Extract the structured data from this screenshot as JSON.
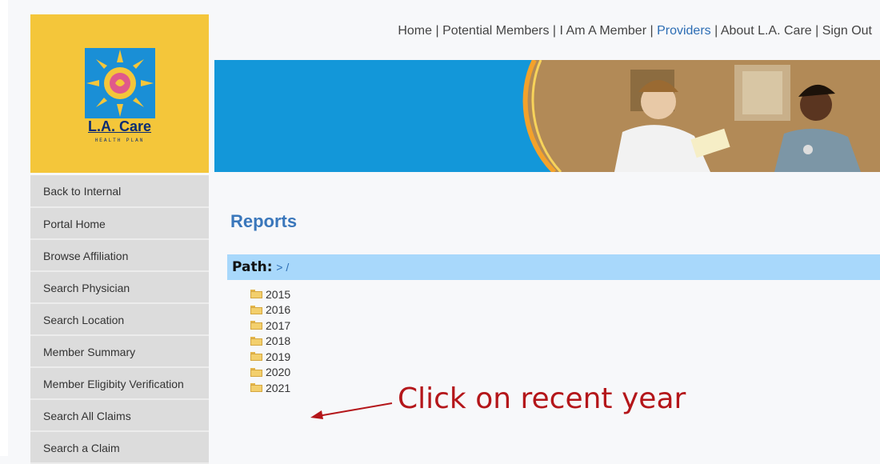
{
  "logo": {
    "brand": "L.A. Care",
    "sub": "HEALTH PLAN"
  },
  "top_nav": [
    {
      "label": "Home",
      "active": false
    },
    {
      "label": "Potential Members",
      "active": false
    },
    {
      "label": "I Am A Member",
      "active": false
    },
    {
      "label": "Providers",
      "active": true
    },
    {
      "label": "About L.A. Care",
      "active": false
    },
    {
      "label": "Sign Out",
      "active": false
    }
  ],
  "sidebar": {
    "items": [
      {
        "label": "Back to Internal"
      },
      {
        "label": "Portal Home"
      },
      {
        "label": "Browse Affiliation"
      },
      {
        "label": "Search Physician"
      },
      {
        "label": "Search Location"
      },
      {
        "label": "Member Summary"
      },
      {
        "label": "Member Eligibity Verification"
      },
      {
        "label": "Search All Claims"
      },
      {
        "label": "Search a Claim"
      }
    ]
  },
  "main": {
    "title": "Reports",
    "path_label": "Path:",
    "path_value": "> /",
    "folders": [
      "2015",
      "2016",
      "2017",
      "2018",
      "2019",
      "2020",
      "2021"
    ]
  },
  "annotation": {
    "text": "Click on recent year"
  },
  "colors": {
    "accent": "#2c6db4",
    "logo_bg": "#f4c63a",
    "banner": "#1397d9",
    "path_bar": "#a8d8fb",
    "annotation": "#b4161a"
  }
}
